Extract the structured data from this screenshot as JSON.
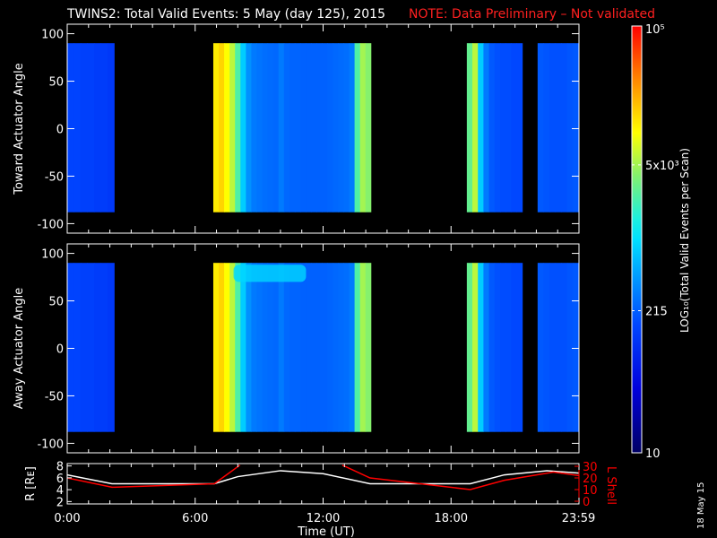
{
  "chart_data": {
    "type": "heatmap",
    "title": "TWINS2: Total Valid Events:  5 May (day 125), 2015",
    "note": "NOTE: Data Preliminary – Not validated",
    "xlabel": "Time (UT)",
    "xlim_hours": [
      0,
      24
    ],
    "x_ticks": [
      {
        "h": 0,
        "label": "0:00"
      },
      {
        "h": 6,
        "label": "6:00"
      },
      {
        "h": 12,
        "label": "12:00"
      },
      {
        "h": 18,
        "label": "18:00"
      },
      {
        "h": 23.98,
        "label": "23:59"
      }
    ],
    "angle_ticks": [
      100,
      50,
      0,
      -50,
      -100
    ],
    "angle_tick_labels": [
      "100",
      "50",
      "0",
      "-50",
      "-100"
    ],
    "angle_range": [
      -110,
      110
    ],
    "panels": [
      {
        "ylabel": "Toward Actuator Angle",
        "ylim": [
          -110,
          110
        ]
      },
      {
        "ylabel": "Away Actuator Angle",
        "ylim": [
          -110,
          110
        ]
      }
    ],
    "segments": [
      {
        "start": 0.0,
        "end": 2.2,
        "angle_min": -88,
        "angle_max": 90,
        "counts": [
          150,
          150,
          140,
          140,
          130,
          130,
          120
        ]
      },
      {
        "start": 6.85,
        "end": 14.24,
        "angle_min": -88,
        "angle_max": 90,
        "counts": [
          12000,
          15000,
          10000,
          6000,
          2500,
          800,
          400,
          300,
          280,
          260,
          250,
          240,
          300,
          240,
          230,
          230,
          220,
          220,
          220,
          220,
          220,
          230,
          240,
          250,
          260,
          300,
          2500,
          5000,
          4000
        ]
      },
      {
        "start": 18.74,
        "end": 21.34,
        "angle_min": -88,
        "angle_max": 90,
        "counts": [
          3000,
          6000,
          800,
          300,
          200,
          180,
          170,
          170,
          160,
          160
        ]
      },
      {
        "start": 22.06,
        "end": 24.0,
        "angle_min": -88,
        "angle_max": 90,
        "counts": [
          200,
          190,
          180,
          180,
          180,
          190,
          200
        ]
      }
    ],
    "colorbar": {
      "label": "LOG₁₀(Total Valid Events per Scan)",
      "min": 10,
      "max": 100000,
      "tick_labels": [
        "10",
        "215",
        "5x10³",
        "10⁵"
      ],
      "tick_values": [
        10,
        215,
        5000,
        100000
      ]
    },
    "orbit": {
      "ylabel_left": "R [Rᴇ]",
      "ylabel_right": "L Shell",
      "r_ticks": [
        "2",
        "4",
        "6",
        "8"
      ],
      "l_ticks": [
        "0",
        "10",
        "20",
        "30"
      ],
      "r_range": [
        1.6,
        8.4
      ],
      "l_range": [
        0,
        30
      ],
      "r_series": [
        [
          0,
          6.5
        ],
        [
          2.1,
          5.0
        ],
        [
          6.9,
          5.0
        ],
        [
          8,
          6.2
        ],
        [
          10,
          7.2
        ],
        [
          12,
          6.7
        ],
        [
          14.2,
          5.0
        ],
        [
          18.9,
          5.0
        ],
        [
          20.5,
          6.5
        ],
        [
          22.5,
          7.2
        ],
        [
          24,
          6.8
        ]
      ],
      "l_series": [
        [
          [
            0,
            20
          ],
          [
            2.1,
            12
          ],
          [
            6.9,
            15
          ],
          [
            8.1,
            31
          ]
        ],
        [
          [
            12.9,
            31
          ],
          [
            14.2,
            20
          ],
          [
            18.9,
            10
          ],
          [
            20.5,
            18
          ],
          [
            22.8,
            25
          ],
          [
            24,
            22
          ]
        ]
      ],
      "r_color": "#ffffff",
      "l_color": "#ff0000"
    },
    "date_stamp": "18 May 15"
  }
}
